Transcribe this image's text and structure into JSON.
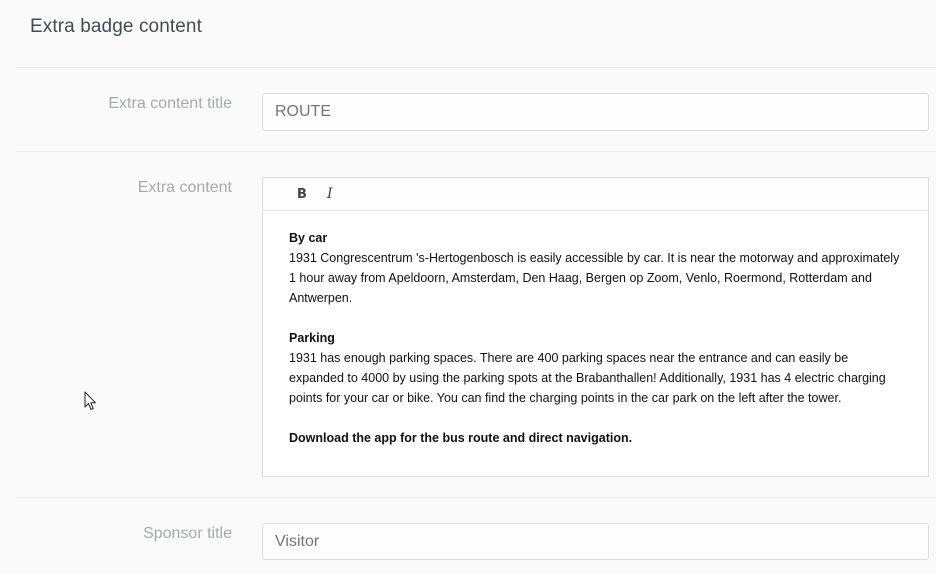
{
  "section": {
    "title": "Extra badge content"
  },
  "fields": {
    "extra_content_title": {
      "label": "Extra content title",
      "value": "",
      "placeholder": "ROUTE"
    },
    "extra_content": {
      "label": "Extra content",
      "toolbar": {
        "bold": "B",
        "italic": "I"
      },
      "blocks": {
        "car_heading": "By car",
        "car_text": "1931 Congrescentrum 's-Hertogenbosch is easily accessible by car. It is near the motorway and approximately 1 hour away from Apeldoorn, Amsterdam, Den Haag, Bergen op Zoom, Venlo, Roermond, Rotterdam and Antwerpen.",
        "parking_heading": "Parking",
        "parking_text": "1931 has enough parking spaces. There are 400 parking spaces near the entrance and can easily be expanded to 4000 by using the parking spots at the Brabanthallen! Additionally, 1931 has 4 electric charging points for your car or bike. You can find the charging points in the car park on the left after the tower.",
        "download_text": "Download the app for the bus route and direct navigation."
      }
    },
    "sponsor_title": {
      "label": "Sponsor title",
      "value": "",
      "placeholder": "Visitor"
    }
  },
  "icons": {
    "cursor": "mouse-pointer-icon"
  }
}
